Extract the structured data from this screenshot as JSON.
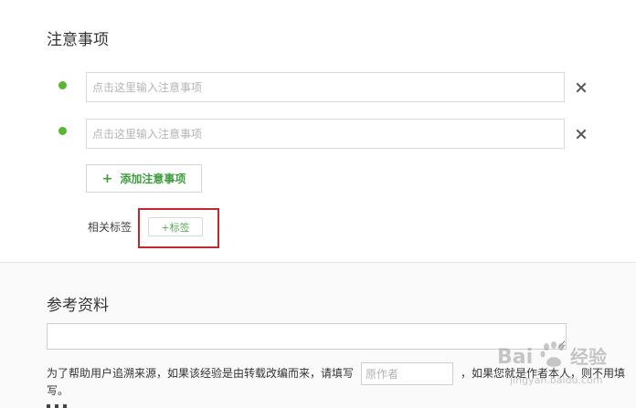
{
  "notes_section": {
    "title": "注意事项",
    "items": [
      {
        "placeholder": "点击这里输入注意事项",
        "value": ""
      },
      {
        "placeholder": "点击这里输入注意事项",
        "value": ""
      }
    ],
    "add_button_plus": "+",
    "add_button_label": "添加注意事项"
  },
  "tags": {
    "label": "相关标签",
    "add_tag_label": "+标签"
  },
  "references_section": {
    "title": "参考资料",
    "textarea_value": "",
    "source_text_before": "为了帮助用户追溯来源，如果该经验是由转载改编而来，请填写",
    "author_placeholder": "原作者",
    "source_text_after": "，如果您就是作者本人，则不用填",
    "source_text_wrap": "写。"
  },
  "watermark": {
    "brand": "Bai",
    "brand_suffix": "经验",
    "url": "jingyan.baidu.com"
  },
  "colors": {
    "accent_green": "#5cb531",
    "highlight_red": "#c0282d"
  }
}
